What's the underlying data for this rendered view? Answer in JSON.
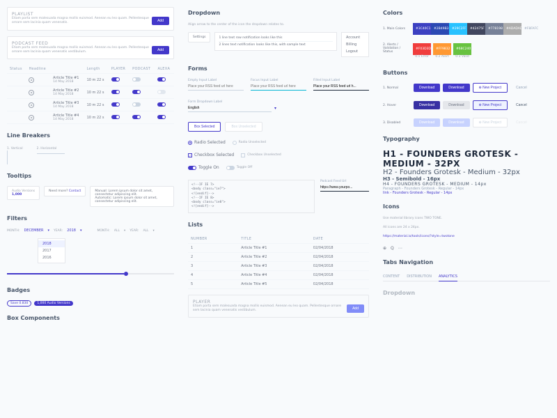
{
  "col1": {
    "playlist": {
      "title": "PLAYLIST",
      "lorem": "Etiam porta sem malesuada magna mollis euismod. Aenean eu leo quam. Pellentesque ornare sem lacinia quam venenatis.",
      "btn": "Add"
    },
    "podcast": {
      "title": "PODCAST FEED",
      "lorem": "Etiam porta sem malesuada magna mollis euismod. Aenean eu leo quam. Pellentesque ornare sem lacinia quam venenatis vestibulum.",
      "btn": "Add"
    },
    "table": {
      "headers": [
        "Status",
        "Headline",
        "Length",
        "PLAYER",
        "PODCAST",
        "ALEXA"
      ],
      "rows": [
        {
          "title": "Article Title #1",
          "date": "14 May 2018",
          "len": "10 m 22 s",
          "player": true,
          "alexa": true
        },
        {
          "title": "Article Title #2",
          "date": "14 May 2018",
          "len": "10 m 22 s",
          "player": true,
          "alexa": false
        },
        {
          "title": "Article Title #3",
          "date": "14 May 2018",
          "len": "10 m 22 s",
          "player": true,
          "alexa": true
        },
        {
          "title": "Article Title #4",
          "date": "14 May 2018",
          "len": "10 m 22 s",
          "player": true,
          "alexa": true
        }
      ]
    },
    "linebreakers": {
      "title": "Line Breakers",
      "v": "1. Vertical",
      "h": "2. Horizontal"
    },
    "tooltips": {
      "title": "Tooltips",
      "audio": "Audio Versions",
      "count": "1,000",
      "need": "Need more?",
      "contact": "Contact",
      "tip": "Manual: Lorem ipsum dolor sit amet, consectetur adipiscing elit.\nAutomatic: Lorem ipsum dolor sit amet, consectetur adipiscing elit."
    },
    "filters": {
      "title": "Filters",
      "month": "MONTH:",
      "monthVal": "DECEMBER",
      "year": "YEAR:",
      "yearVal": "2018",
      "all": "ALL",
      "dd": [
        "2018",
        "2017",
        "2016"
      ]
    },
    "badges": {
      "title": "Badges",
      "b1": "Save 0.830",
      "b2": "1,000 Audio Versions"
    },
    "boxcomp": {
      "title": "Box Components"
    }
  },
  "col2": {
    "dropdown": {
      "title": "Dropdown",
      "sub": "Align arrow to the center of the icon the dropdown relates to.",
      "settings": "Settings",
      "n1": "1 line text row notification looks like this",
      "n2": "2 lines text notification looks like this, with sample text",
      "menu": [
        "Account",
        "Billing",
        "Logout"
      ]
    },
    "forms": {
      "title": "Forms",
      "empty": {
        "label": "Empty Input Label",
        "ph": "Place your RSS feed url here"
      },
      "focus": {
        "label": "Focus Input Label",
        "ph": "Place your RSS feed url here"
      },
      "filled": {
        "label": "Filled Input Label",
        "val": "Place your RSS feed url h..."
      },
      "dd": {
        "label": "Form Dropdown Label",
        "val": "English"
      },
      "boxSel": "Box Selected",
      "boxUn": "Box Unselected",
      "radioSel": "Radio Selected",
      "radioUn": "Radio Unselected",
      "cbSel": "Checkbox Selected",
      "cbUn": "Checkbox Unselected",
      "tgOn": "Toggle On",
      "tgOff": "Toggle Off",
      "code": "<!--IF IE 7>\n<body class=\"ie7\">\n<![endif]-->\n<!--IF IE 8>\n<body class=\"ie8\">\n<![endif]-->",
      "feedUrl": {
        "label": "Podcast Feed Url",
        "val": "https://www.yourpo..."
      }
    },
    "lists": {
      "title": "Lists",
      "headers": [
        "NUMBER",
        "TITLE",
        "DATE"
      ],
      "rows": [
        {
          "n": "1",
          "t": "Article Title #1",
          "d": "02/04/2018"
        },
        {
          "n": "2",
          "t": "Article Title #2",
          "d": "02/04/2018"
        },
        {
          "n": "3",
          "t": "Article Title #3",
          "d": "02/04/2018"
        },
        {
          "n": "4",
          "t": "Article Title #4",
          "d": "02/04/2018"
        },
        {
          "n": "5",
          "t": "Article Title #5",
          "d": "02/04/2018"
        }
      ]
    },
    "player": {
      "title": "PLAYER",
      "lorem": "Etiam porta sem malesuada magna mollis euismod. Aenean eu leo quam. Pellentesque ornare sem lacinia quam venenatis vestibulum.",
      "btn": "Add"
    }
  },
  "col3": {
    "colors": {
      "title": "Colors",
      "main": {
        "label": "1. Main Colors",
        "swatches": [
          {
            "hex": "#3C40C1"
          },
          {
            "hex": "#2B49B3"
          },
          {
            "hex": "#29C2FF"
          },
          {
            "hex": "#42475F"
          },
          {
            "hex": "#778198"
          },
          {
            "hex": "#ADADAD"
          },
          {
            "hex": "#F8FAFC"
          }
        ]
      },
      "alerts": {
        "label": "2. Alerts / Validation / Status",
        "swatches": [
          {
            "hex": "#F03D3D",
            "txt": "0.1 Error"
          },
          {
            "hex": "#FF9832",
            "txt": "0.2 Alert"
          },
          {
            "hex": "#68C240",
            "txt": "0.3 Valid"
          }
        ]
      }
    },
    "buttons": {
      "title": "Buttons",
      "r1": "1. Normal",
      "r2": "2. Hover",
      "r3": "3. Disabled",
      "dl": "Download",
      "np": "New Project",
      "cancel": "Cancel"
    },
    "typo": {
      "title": "Typography",
      "h1": "H1 - FOUNDERS GROTESK - MEDIUM - 32PX",
      "h2": "H2 - Founders Grotesk - Medium - 32px",
      "h3": "H3 - Semibold - 16px",
      "h4": "H4 - FOUNDERS GROTESK - MEDIUM - 14px",
      "p": "Paragraph - Founders Grotesk - Regular - 14px",
      "link": "link - Founders Grotesk - Regular - 14px"
    },
    "icons": {
      "title": "Icons",
      "line1": "Use material library icons TWO TONE.",
      "line2": "All icons are 24 x 24px.",
      "line3": "https://material.io/tools/icons/?style=twotone"
    },
    "tabs": {
      "title": "Tabs Navigation",
      "items": [
        "CONTENT",
        "DISTRIBUTION",
        "ANALYTICS"
      ],
      "active": 2
    },
    "dd2": {
      "title": "Dropdown"
    }
  }
}
